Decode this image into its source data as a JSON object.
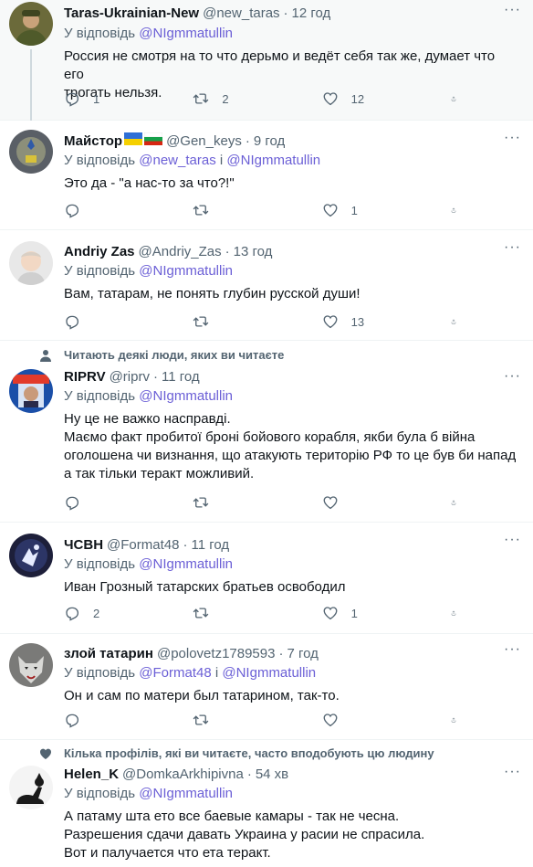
{
  "tweets": [
    {
      "name": "Taras-Ukrainian-New",
      "handle": "@new_taras",
      "time": "12 год",
      "reply_prefix": "У відповідь",
      "reply_to": [
        "@NIgmmatullin"
      ],
      "lines": [
        "Россия не смотря на то что дерьмо и ведёт себя так же, думает что его",
        "трогать нельзя."
      ],
      "counts": {
        "reply": "1",
        "retweet": "2",
        "like": "12"
      }
    },
    {
      "name": "Майстор",
      "handle": "@Gen_keys",
      "time": "9 год",
      "reply_prefix": "У відповідь",
      "reply_to": [
        "@new_taras",
        "@NIgmmatullin"
      ],
      "joiner": "і",
      "lines": [
        "Это да - \"а нас-то за что?!\""
      ],
      "counts": {
        "reply": "",
        "retweet": "",
        "like": "1"
      }
    },
    {
      "name": "Andriy Zas",
      "handle": "@Andriy_Zas",
      "time": "13 год",
      "reply_prefix": "У відповідь",
      "reply_to": [
        "@NIgmmatullin"
      ],
      "lines": [
        "Вам, татарам, не понять глубин русской души!"
      ],
      "counts": {
        "reply": "",
        "retweet": "",
        "like": "13"
      }
    },
    {
      "social": "Читають деякі люди, яких ви читаєте",
      "name": "RIPRV",
      "handle": "@riprv",
      "time": "11 год",
      "reply_prefix": "У відповідь",
      "reply_to": [
        "@NIgmmatullin"
      ],
      "lines": [
        "Ну це не важко насправді.",
        "Маємо факт пробитої броні бойового корабля, якби була б війна",
        "оголошена чи визнання, що атакують територію РФ то це був би напад",
        "а так тільки теракт можливий."
      ],
      "counts": {
        "reply": "",
        "retweet": "",
        "like": ""
      }
    },
    {
      "name": "ЧСВН",
      "handle": "@Format48",
      "time": "11 год",
      "reply_prefix": "У відповідь",
      "reply_to": [
        "@NIgmmatullin"
      ],
      "lines": [
        "Иван Грозный татарских братьев освободил"
      ],
      "counts": {
        "reply": "2",
        "retweet": "",
        "like": "1"
      }
    },
    {
      "name": "злой татарин",
      "handle": "@polovetz1789593",
      "time": "7 год",
      "reply_prefix": "У відповідь",
      "reply_to": [
        "@Format48",
        "@NIgmmatullin"
      ],
      "joiner": "і",
      "lines": [
        "Он и сам по матери был татарином, так-то."
      ],
      "counts": {
        "reply": "",
        "retweet": "",
        "like": ""
      }
    },
    {
      "social": "Кілька профілів, які ви читаєте, часто вподобують цю людину",
      "name": "Helen_K",
      "handle": "@DomkaArkhipivna",
      "time": "54 хв",
      "reply_prefix": "У відповідь",
      "reply_to": [
        "@NIgmmatullin"
      ],
      "lines": [
        "А патаму шта ето все баевые камары - так не чесна.",
        "Разрешения сдачи давать Украина у расии не спрасила.",
        "Вот и палучается что ета теракт."
      ],
      "counts": {
        "reply": "",
        "retweet": "",
        "like": ""
      }
    }
  ],
  "colors": {
    "text": "#0f1419",
    "secondary": "#536471",
    "mention": "#6b5fd6",
    "border": "#eff3f4",
    "highlight": "#f7f9f9"
  },
  "icons": {
    "reply": "reply-icon",
    "retweet": "retweet-icon",
    "like": "heart-icon",
    "share": "share-icon",
    "more": "more-icon",
    "social_person": "person-icon",
    "social_heart": "heart-filled-icon"
  }
}
